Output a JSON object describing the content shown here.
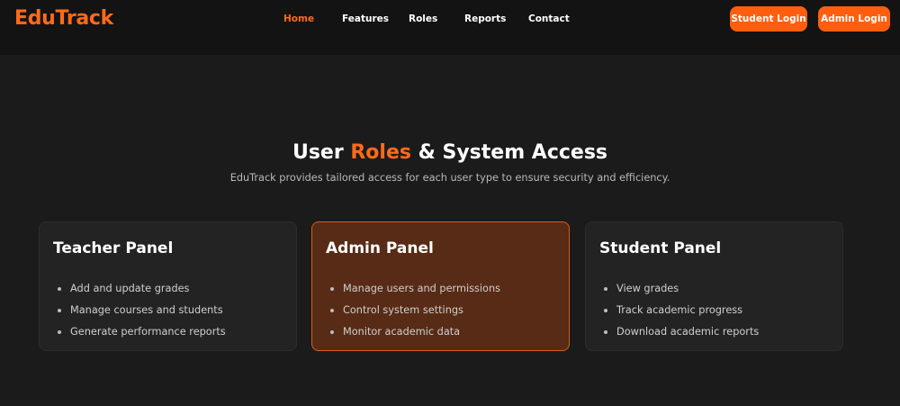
{
  "brand": {
    "logo": "EduTrack",
    "accent_color": "#ff6a1a"
  },
  "nav": {
    "links": [
      {
        "label": "Home",
        "active": true
      },
      {
        "label": "Features",
        "active": false
      },
      {
        "label": "Roles",
        "active": false
      },
      {
        "label": "Reports",
        "active": false
      },
      {
        "label": "Contact",
        "active": false
      }
    ],
    "student_login": "Student Login",
    "admin_login": "Admin Login"
  },
  "hero": {
    "title_start": "User ",
    "title_accent": "Roles",
    "title_end": " & System Access",
    "subtitle": "EduTrack provides tailored access for each user type to ensure security and efficiency."
  },
  "cards": [
    {
      "title": "Teacher Panel",
      "highlighted": false,
      "items": [
        "Add and update grades",
        "Manage courses and students",
        "Generate performance reports"
      ]
    },
    {
      "title": "Admin Panel",
      "highlighted": true,
      "items": [
        "Manage users and permissions",
        "Control system settings",
        "Monitor academic data"
      ]
    },
    {
      "title": "Student Panel",
      "highlighted": false,
      "items": [
        "View grades",
        "Track academic progress",
        "Download academic reports"
      ]
    }
  ],
  "colors": {
    "background": "#1b1b1b",
    "navbar": "#131313",
    "button": "#ff5e0e",
    "card": "#232323",
    "card_highlight": "#572b15",
    "card_highlight_border": "#d85d1f"
  }
}
